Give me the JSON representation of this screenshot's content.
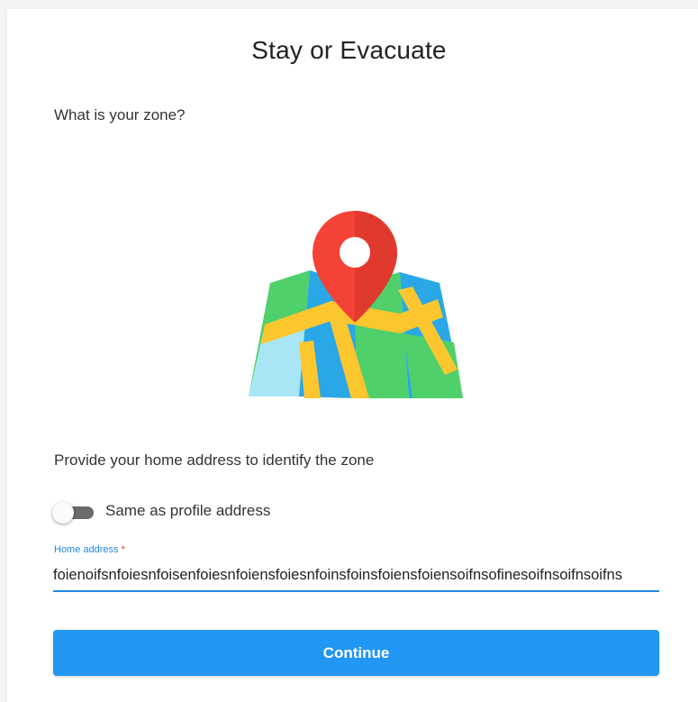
{
  "header": {
    "title": "Stay or Evacuate"
  },
  "main": {
    "question": "What is your zone?",
    "illustration_icon": "map-pin-on-map-icon",
    "instruction": "Provide your home address to identify the zone"
  },
  "toggle": {
    "label": "Same as profile address",
    "checked": false
  },
  "home_address": {
    "label": "Home address",
    "required_marker": "*",
    "value": "foienoifsnfoiesnfoisenfoiesnfoiensfoiesnfoinsfoinsfoiensfoiensoifnsofinesoifnsoifnsoifns"
  },
  "actions": {
    "continue_label": "Continue"
  },
  "colors": {
    "accent": "#2196f3",
    "field_focus": "#1e88e5",
    "required": "#e53935",
    "pin": "#f44336"
  }
}
